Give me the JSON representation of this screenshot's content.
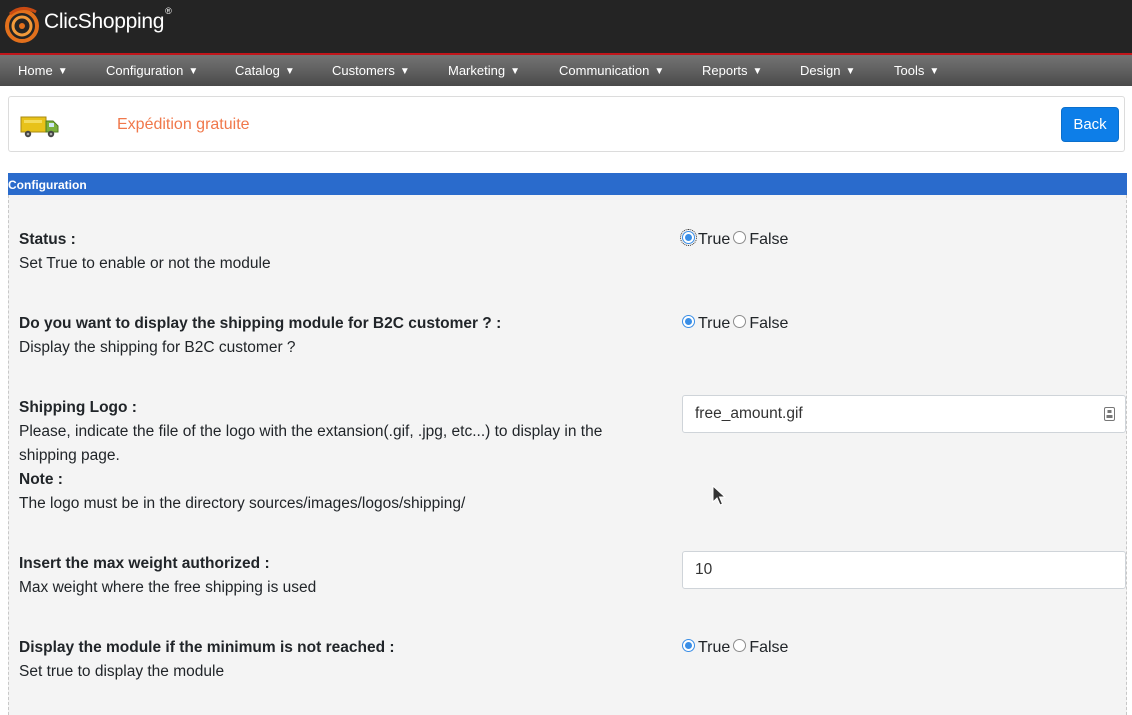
{
  "app": {
    "brand": "ClicShopping",
    "registered_mark": "®"
  },
  "nav": {
    "items": [
      {
        "label": "Home"
      },
      {
        "label": "Configuration"
      },
      {
        "label": "Catalog"
      },
      {
        "label": "Customers"
      },
      {
        "label": "Marketing"
      },
      {
        "label": "Communication"
      },
      {
        "label": "Reports"
      },
      {
        "label": "Design"
      },
      {
        "label": "Tools"
      }
    ],
    "caret": "▼"
  },
  "header": {
    "title": "Expédition gratuite",
    "back_label": "Back"
  },
  "section": {
    "title": "Configuration"
  },
  "settings": [
    {
      "label": "Status :",
      "description": "Set True to enable or not the module",
      "options": [
        "True",
        "False"
      ],
      "selected": "True"
    },
    {
      "label": "Do you want to display the shipping module for B2C customer ? :",
      "description": "Display the shipping for B2C customer ?",
      "options": [
        "True",
        "False"
      ],
      "selected": "True"
    },
    {
      "label": "Shipping Logo :",
      "description": "Please, indicate the file of the logo with the extansion(.gif, .jpg, etc...) to display in the shipping page.",
      "note_label": "Note :",
      "note": "The logo must be in the directory sources/images/logos/shipping/",
      "value": "free_amount.gif"
    },
    {
      "label": "Insert the max weight authorized :",
      "description": "Max weight where the free shipping is used",
      "value": "10"
    },
    {
      "label": "Display the module if the minimum is not reached :",
      "description": "Set true to display the module",
      "options": [
        "True",
        "False"
      ],
      "selected": "True"
    }
  ],
  "colors": {
    "accent": "#2a6bcc",
    "title": "#f0784b",
    "button": "#0d7ee8",
    "header_bg": "#242424",
    "header_border": "#c1161b"
  }
}
